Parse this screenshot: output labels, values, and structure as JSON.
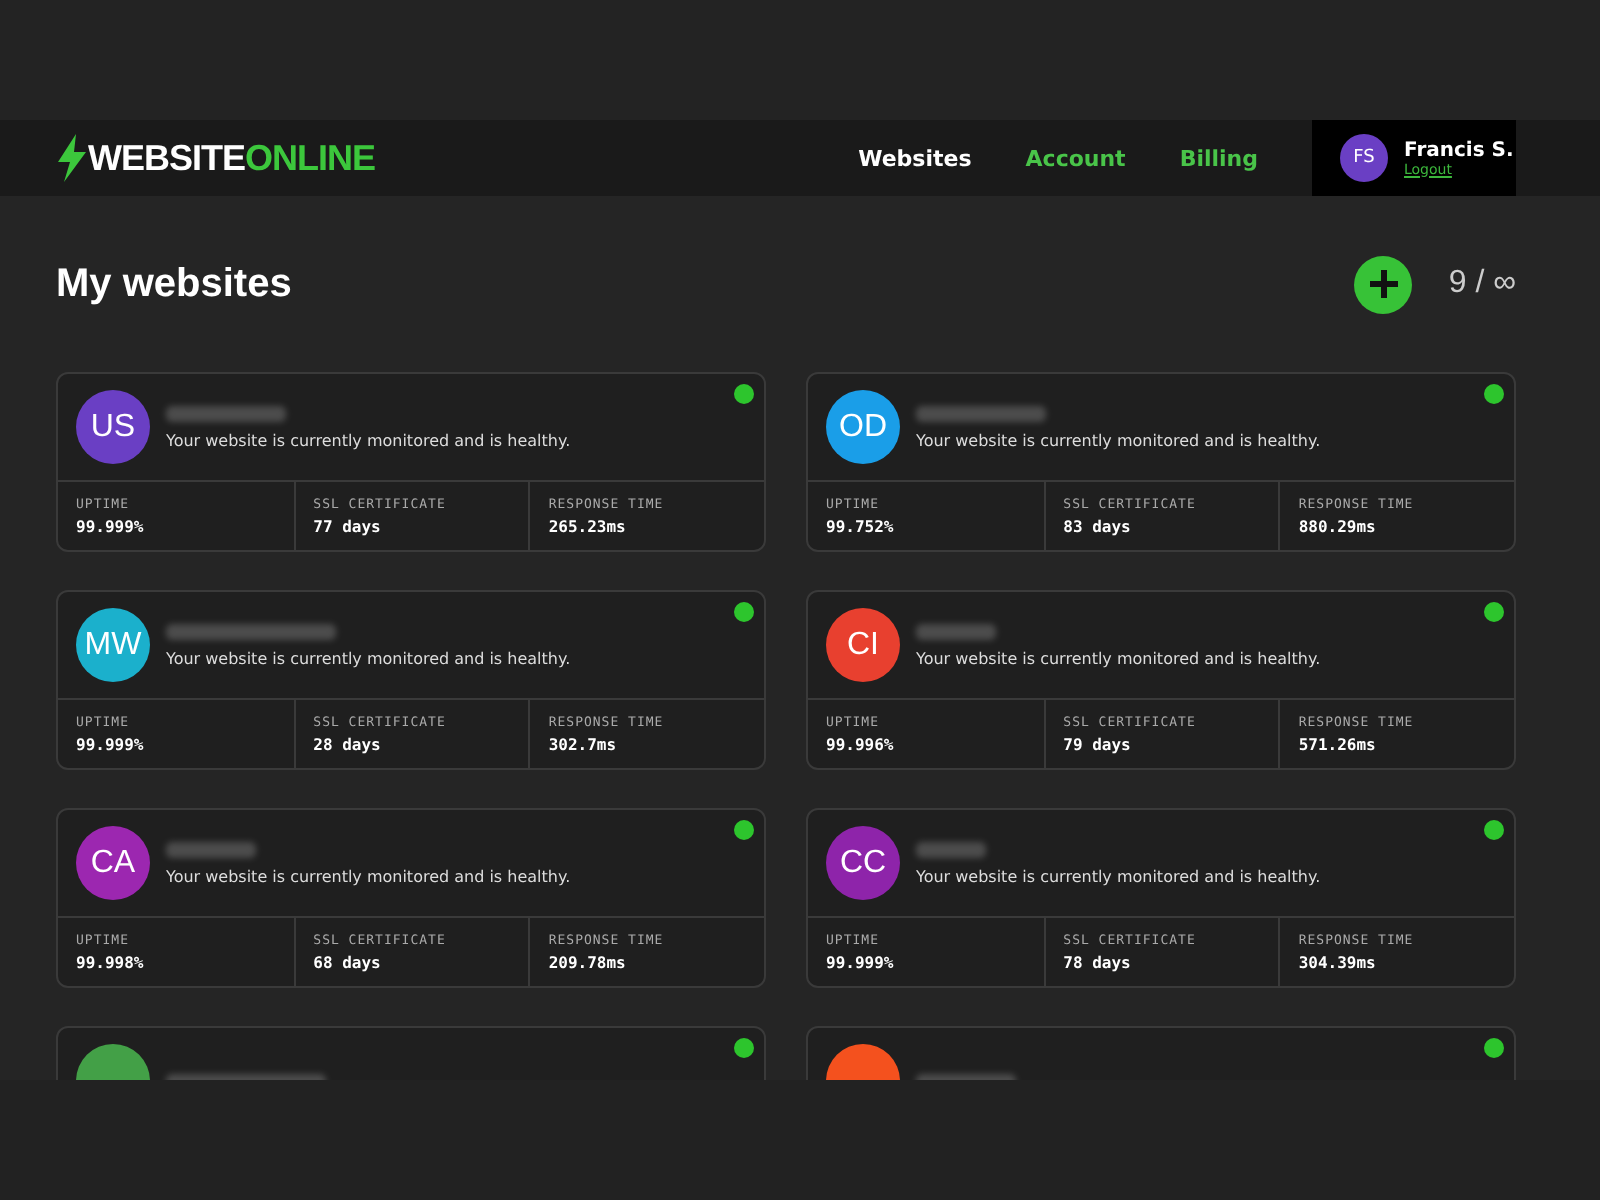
{
  "header": {
    "logo": {
      "first": "WEBSITE",
      "second": "ONLINE"
    },
    "nav": [
      {
        "label": "Websites",
        "selected": true
      },
      {
        "label": "Account",
        "selected": false
      },
      {
        "label": "Billing",
        "selected": false
      }
    ],
    "user": {
      "initials": "FS",
      "name": "Francis S.",
      "logout": "Logout"
    }
  },
  "page": {
    "title": "My websites",
    "count": "9 / ∞"
  },
  "sites": [
    {
      "initials": "US",
      "color": "#6a3fc4",
      "blurred": true,
      "healthy": true,
      "message": "Your website is currently monitored and is healthy.",
      "stats": [
        {
          "label": "UPTIME",
          "value": "99.999%"
        },
        {
          "label": "SSL CERTIFICATE",
          "value": "77 days"
        },
        {
          "label": "RESPONSE TIME",
          "value": "265.23ms"
        }
      ]
    },
    {
      "initials": "OD",
      "color": "#1a9ee8",
      "blurred": true,
      "healthy": true,
      "message": "Your website is currently monitored and is healthy.",
      "stats": [
        {
          "label": "UPTIME",
          "value": "99.752%"
        },
        {
          "label": "SSL CERTIFICATE",
          "value": "83 days"
        },
        {
          "label": "RESPONSE TIME",
          "value": "880.29ms"
        }
      ]
    },
    {
      "initials": "MW",
      "color": "#1bb0cc",
      "blurred": true,
      "healthy": true,
      "message": "Your website is currently monitored and is healthy.",
      "stats": [
        {
          "label": "UPTIME",
          "value": "99.999%"
        },
        {
          "label": "SSL CERTIFICATE",
          "value": "28 days"
        },
        {
          "label": "RESPONSE TIME",
          "value": "302.7ms"
        }
      ]
    },
    {
      "initials": "CI",
      "color": "#e8402f",
      "blurred": true,
      "healthy": true,
      "message": "Your website is currently monitored and is healthy.",
      "stats": [
        {
          "label": "UPTIME",
          "value": "99.996%"
        },
        {
          "label": "SSL CERTIFICATE",
          "value": "79 days"
        },
        {
          "label": "RESPONSE TIME",
          "value": "571.26ms"
        }
      ]
    },
    {
      "initials": "CA",
      "color": "#9c27b0",
      "blurred": true,
      "healthy": true,
      "message": "Your website is currently monitored and is healthy.",
      "stats": [
        {
          "label": "UPTIME",
          "value": "99.998%"
        },
        {
          "label": "SSL CERTIFICATE",
          "value": "68 days"
        },
        {
          "label": "RESPONSE TIME",
          "value": "209.78ms"
        }
      ]
    },
    {
      "initials": "CC",
      "color": "#8e24aa",
      "blurred": true,
      "healthy": true,
      "message": "Your website is currently monitored and is healthy.",
      "stats": [
        {
          "label": "UPTIME",
          "value": "99.999%"
        },
        {
          "label": "SSL CERTIFICATE",
          "value": "78 days"
        },
        {
          "label": "RESPONSE TIME",
          "value": "304.39ms"
        }
      ]
    },
    {
      "color": "#43a047",
      "blurred": true,
      "healthy": true
    },
    {
      "color": "#f4511e",
      "blurred": true,
      "healthy": true
    }
  ]
}
